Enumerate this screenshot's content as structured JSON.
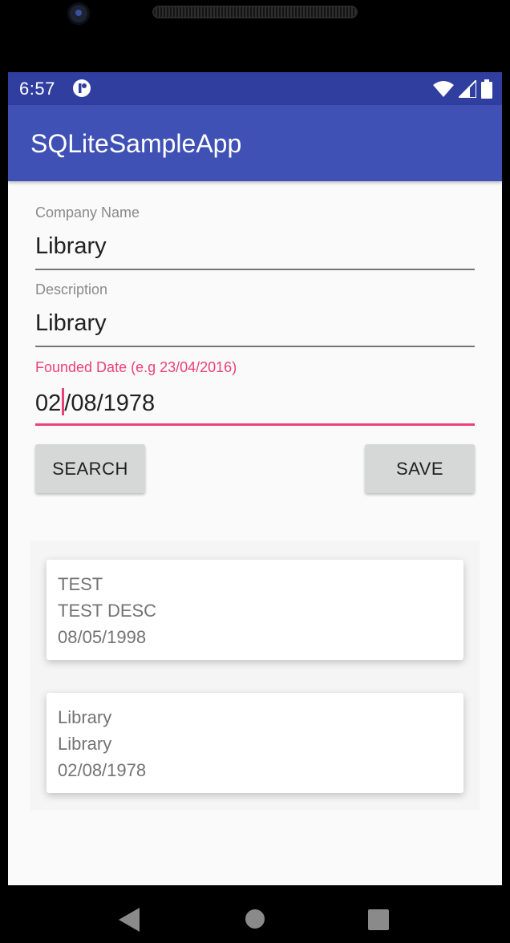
{
  "status_bar": {
    "time": "6:57"
  },
  "app_bar": {
    "title": "SQLiteSampleApp"
  },
  "form": {
    "company_name": {
      "label": "Company Name",
      "value": "Library"
    },
    "description": {
      "label": "Description",
      "value": "Library"
    },
    "founded_date": {
      "label": "Founded Date (e.g 23/04/2016)",
      "value_before_cursor": "02",
      "value_after_cursor": "/08/1978"
    }
  },
  "buttons": {
    "search": "SEARCH",
    "save": "SAVE"
  },
  "list": {
    "items": [
      {
        "name": "TEST",
        "description": "TEST DESC",
        "date": "08/05/1998"
      },
      {
        "name": "Library",
        "description": "Library",
        "date": "02/08/1978"
      }
    ]
  },
  "colors": {
    "status_bar": "#303f9f",
    "app_bar": "#3f51b5",
    "accent": "#ec407a"
  },
  "icons": {
    "notification": "app-notification-icon",
    "wifi": "wifi-icon",
    "signal": "cell-signal-icon",
    "battery": "battery-icon",
    "back": "back-icon",
    "home": "home-icon",
    "recents": "recents-icon"
  }
}
